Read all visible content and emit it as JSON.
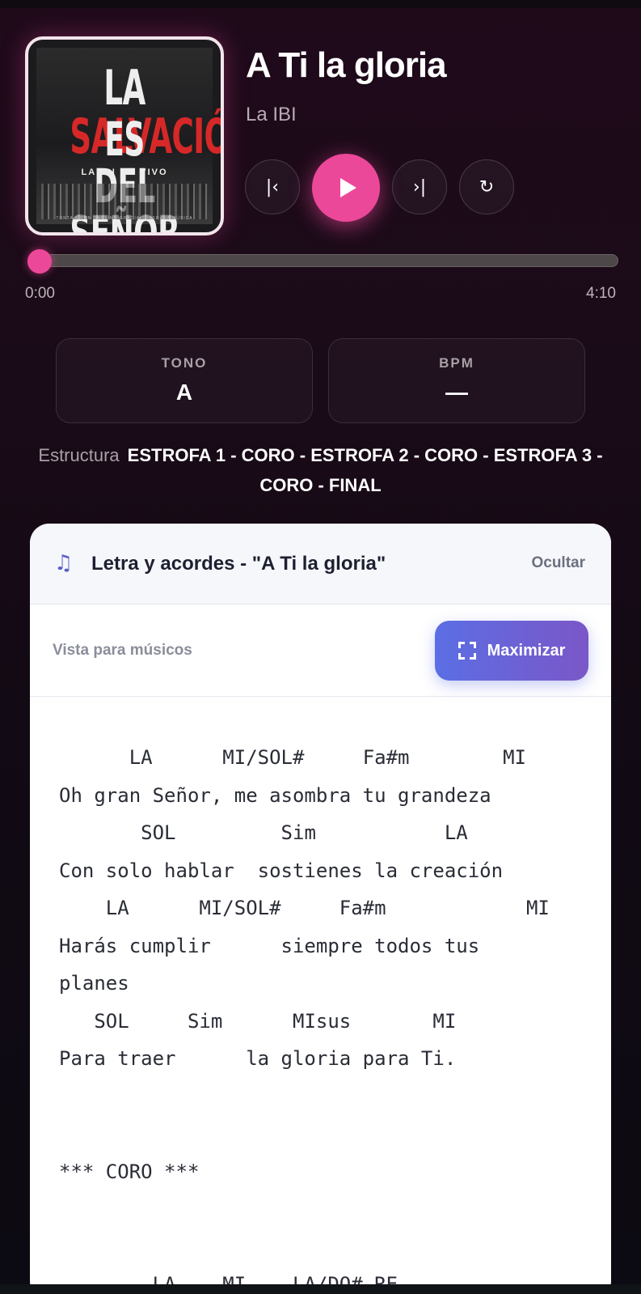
{
  "song": {
    "title": "A Ti la gloria",
    "artist": "La IBI"
  },
  "album_art": {
    "line1_a": "LA",
    "line1_b": "SALVACIÓN",
    "line2": "ES DEL SEÑOR",
    "line3": "LA IBI  EN VIVO",
    "line4": "TORTA A RON GAGLIN · GRACIA SOBERANA MÚSICA"
  },
  "player": {
    "prev_icon": "|‹",
    "next_icon": "›|",
    "repeat_icon": "↻",
    "progress_fraction": 0.0,
    "time_current": "0:00",
    "time_total": "4:10"
  },
  "info": {
    "tono_label": "TONO",
    "tono_value": "A",
    "bpm_label": "BPM",
    "bpm_value": "—"
  },
  "structure": {
    "label": "Estructura",
    "value": "ESTROFA 1 - CORO - ESTROFA 2 - CORO - ESTROFA 3 - CORO - FINAL"
  },
  "lyrics_card": {
    "icon": "♫",
    "title": "Letra y acordes - \"A Ti la gloria\"",
    "hide_label": "Ocultar",
    "view_label": "Vista para músicos",
    "maximize_label": "Maximizar",
    "content": "      LA      MI/SOL#     Fa#m        MI\nOh gran Señor, me asombra tu grandeza\n       SOL         Sim           LA\nCon solo hablar  sostienes la creación\n    LA      MI/SOL#     Fa#m            MI\nHarás cumplir      siempre todos tus\nplanes\n   SOL     Sim      MIsus       MI\nPara traer      la gloria para Ti.\n\n\n*** CORO ***\n\n\n        LA    MI    LA/DO# RE"
  },
  "colors": {
    "accent": "#ec4899",
    "button_gradient_start": "#5b6ee4",
    "button_gradient_end": "#7b57c8"
  }
}
